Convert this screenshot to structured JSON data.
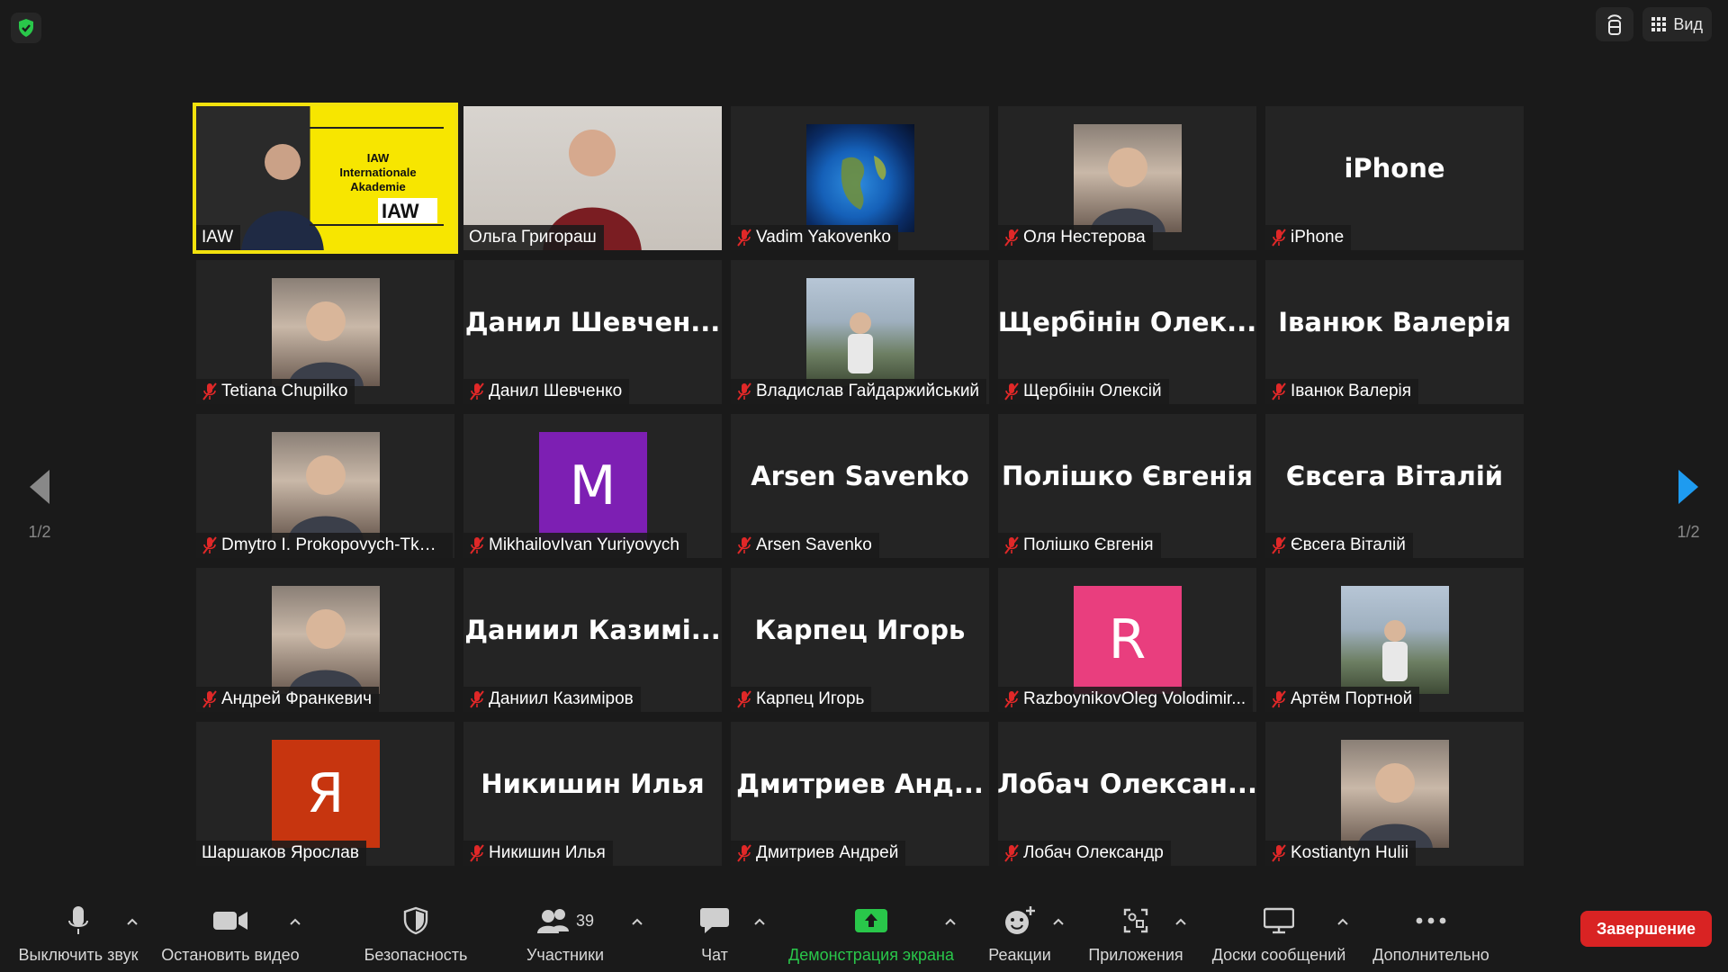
{
  "top": {
    "view_label": "Вид"
  },
  "pager": {
    "left": "1/2",
    "right": "1/2"
  },
  "tiles": [
    {
      "type": "video",
      "name": "IAW",
      "muted": false,
      "speaking": true,
      "text_lines": [
        "IAW",
        "Internationale",
        "Akademie"
      ],
      "logo": "IAW"
    },
    {
      "type": "video",
      "name": "Ольга Григораш",
      "muted": false
    },
    {
      "type": "photo",
      "name": "Vadim Yakovenko",
      "muted": true,
      "photo": "earth"
    },
    {
      "type": "photo",
      "name": "Оля Нестерова",
      "muted": true,
      "photo": "person"
    },
    {
      "type": "text",
      "name": "iPhone",
      "big": "iPhone",
      "muted": true
    },
    {
      "type": "photo",
      "name": "Tetiana Chupilko",
      "muted": true,
      "photo": "person"
    },
    {
      "type": "text",
      "name": "Данил Шевченко",
      "big": "Данил  Шевчен...",
      "muted": true
    },
    {
      "type": "photo",
      "name": "Владислав Гайдаржийський",
      "muted": true,
      "photo": "outdoor"
    },
    {
      "type": "text",
      "name": "Щербінін Олексій",
      "big": "Щербінін  Олек...",
      "muted": true
    },
    {
      "type": "text",
      "name": "Іванюк Валерія",
      "big": "Іванюк Валерія",
      "muted": true
    },
    {
      "type": "photo",
      "name": "Dmytro I. Prokopovych-Tkac...",
      "muted": true,
      "photo": "person"
    },
    {
      "type": "letter",
      "name": "MikhailovIvan Yuriyovych",
      "letter": "M",
      "color": "#7d1fb3",
      "muted": true
    },
    {
      "type": "text",
      "name": "Arsen Savenko",
      "big": "Arsen Savenko",
      "muted": true
    },
    {
      "type": "text",
      "name": "Полішко Євгенія",
      "big": "Полішко Євгенія",
      "muted": true
    },
    {
      "type": "text",
      "name": "Євсега Віталій",
      "big": "Євсега Віталій",
      "muted": true
    },
    {
      "type": "photo",
      "name": "Андрей Франкевич",
      "muted": true,
      "photo": "person"
    },
    {
      "type": "text",
      "name": "Даниил Казиміров",
      "big": "Даниил  Казимі...",
      "muted": true
    },
    {
      "type": "text",
      "name": "Карпец Игорь",
      "big": "Карпец Игорь",
      "muted": true
    },
    {
      "type": "letter",
      "name": "RazboynikovOleg Volodimir...",
      "letter": "R",
      "color": "#e93e7e",
      "muted": true
    },
    {
      "type": "photo",
      "name": "Артём Портной",
      "muted": true,
      "photo": "outdoor"
    },
    {
      "type": "letter",
      "name": "Шаршаков Ярослав",
      "letter": "Я",
      "color": "#c7350f",
      "muted": false
    },
    {
      "type": "text",
      "name": "Никишин Илья",
      "big": "Никишин Илья",
      "muted": true
    },
    {
      "type": "text",
      "name": "Дмитриев Андрей",
      "big": "Дмитриев  Анд...",
      "muted": true
    },
    {
      "type": "text",
      "name": "Лобач Олександр",
      "big": "Лобач  Олексан...",
      "muted": true
    },
    {
      "type": "photo",
      "name": "Kostiantyn Hulii",
      "muted": true,
      "photo": "person"
    }
  ],
  "toolbar": {
    "mute": "Выключить звук",
    "video": "Остановить видео",
    "security": "Безопасность",
    "participants": "Участники",
    "participants_count": "39",
    "chat": "Чат",
    "share": "Демонстрация экрана",
    "reactions": "Реакции",
    "apps": "Приложения",
    "whiteboards": "Доски сообщений",
    "more": "Дополнительно",
    "end": "Завершение"
  },
  "colors": {
    "accent_green": "#29c74a",
    "end_red": "#d92323",
    "speaker_border": "#f2e20d"
  }
}
